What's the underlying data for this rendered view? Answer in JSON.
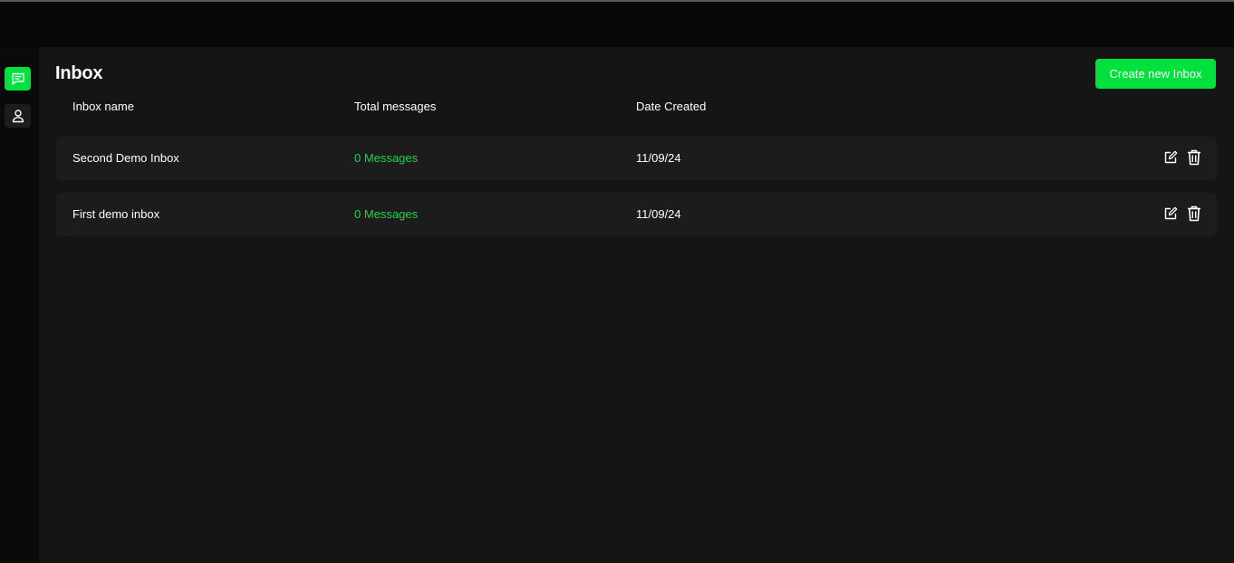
{
  "sidebar": {
    "items": [
      {
        "icon": "chat-icon",
        "active": true
      },
      {
        "icon": "user-icon",
        "active": false
      }
    ]
  },
  "header": {
    "title": "Inbox",
    "create_label": "Create new Inbox"
  },
  "table": {
    "columns": [
      "Inbox name",
      "Total messages",
      "Date Created"
    ],
    "rows": [
      {
        "name": "Second Demo Inbox",
        "messages": "0 Messages",
        "date": "11/09/24"
      },
      {
        "name": "First demo inbox",
        "messages": "0 Messages",
        "date": "11/09/24"
      }
    ]
  },
  "colors": {
    "accent": "#00e13d",
    "message_text": "#19d64a",
    "background": "#151515",
    "row": "#1c1c1c"
  }
}
